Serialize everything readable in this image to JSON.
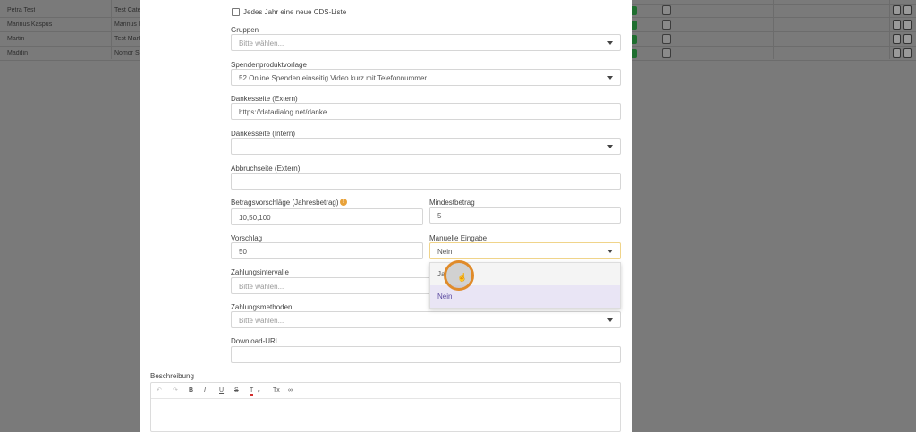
{
  "background_table": {
    "rows": [
      {
        "name": "Petra Test",
        "col2": "Test Cate"
      },
      {
        "name": "Marinus Kaspus",
        "col2": "Marinus K"
      },
      {
        "name": "Martin",
        "col2": "Test Mark"
      },
      {
        "name": "Maddin",
        "col2": "Nomor Sp"
      }
    ]
  },
  "form": {
    "checkbox_label": "Jedes Jahr eine neue CDS-Liste",
    "gruppen": {
      "label": "Gruppen",
      "placeholder": "Bitte wählen..."
    },
    "spendenproduktvorlage": {
      "label": "Spendenproduktvorlage",
      "value": "52 Online Spenden einseitig Video kurz mit Telefonnummer"
    },
    "dankesseite_extern": {
      "label": "Dankesseite (Extern)",
      "value": "https://datadialog.net/danke"
    },
    "dankesseite_intern": {
      "label": "Dankesseite (Intern)",
      "value": ""
    },
    "abbruchseite_extern": {
      "label": "Abbruchseite (Extern)",
      "value": ""
    },
    "betragsvorschlaege": {
      "label": "Betragsvorschläge (Jahresbetrag)",
      "value": "10,50,100"
    },
    "mindestbetrag": {
      "label": "Mindestbetrag",
      "value": "5"
    },
    "vorschlag": {
      "label": "Vorschlag",
      "value": "50"
    },
    "manuelle_eingabe": {
      "label": "Manuelle Eingabe",
      "value": "Nein",
      "options": [
        "Ja",
        "Nein"
      ]
    },
    "zahlungsintervalle": {
      "label": "Zahlungsintervalle",
      "placeholder": "Bitte wählen..."
    },
    "zahlungsmethoden": {
      "label": "Zahlungsmethoden",
      "placeholder": "Bitte wählen..."
    },
    "download_url": {
      "label": "Download-URL",
      "value": ""
    },
    "beschreibung": {
      "label": "Beschreibung"
    }
  },
  "editor_toolbar": {
    "undo": "↶",
    "redo": "↷",
    "bold": "B",
    "italic": "I",
    "underline": "U",
    "strike": "S",
    "text_color": "T",
    "clear": "Tx",
    "link": "∞"
  },
  "colors": {
    "accent": "#e08b2a",
    "selected_option": "#e9e5f5",
    "info": "#e8a23a"
  }
}
